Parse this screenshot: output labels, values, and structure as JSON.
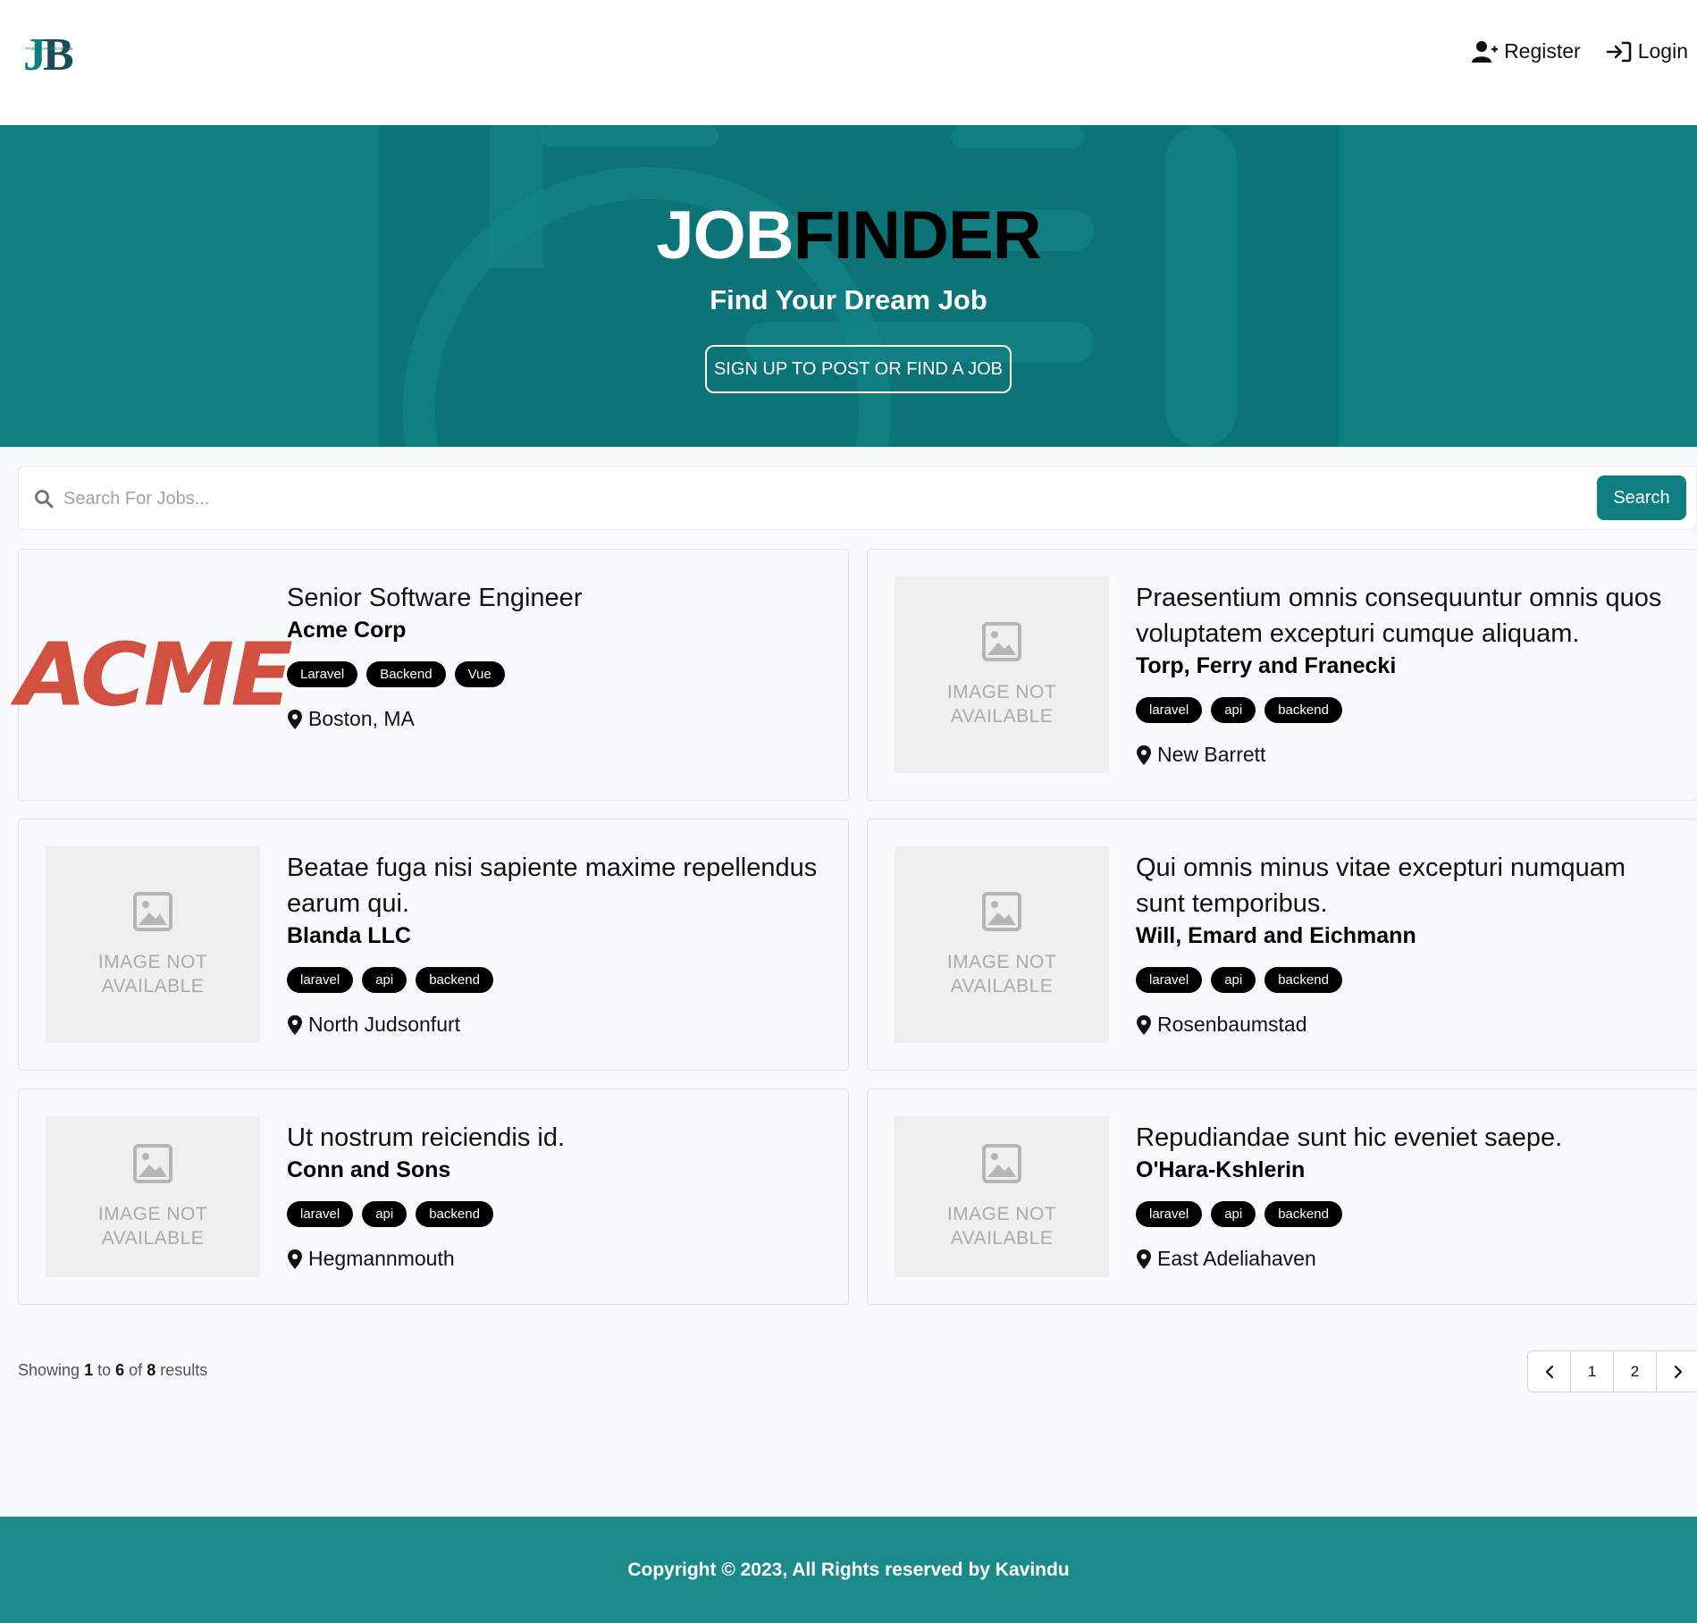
{
  "header": {
    "logo_letters": "JB",
    "logo_tagline": "FIND YOUR DREAM JOB",
    "nav": [
      {
        "label": "Register",
        "icon": "user-plus-icon"
      },
      {
        "label": "Login",
        "icon": "login-icon"
      }
    ]
  },
  "hero": {
    "title_part1": "JOB",
    "title_part2": "FINDER",
    "subtitle": "Find Your Dream Job",
    "button_label": "SIGN UP TO POST OR FIND A JOB"
  },
  "search": {
    "placeholder": "Search For Jobs...",
    "button_label": "Search"
  },
  "jobs": [
    {
      "title": "Senior Software Engineer",
      "company": "Acme Corp",
      "tags": [
        "Laravel",
        "Backend",
        "Vue"
      ],
      "location": "Boston, MA",
      "logo": "ACME"
    },
    {
      "title": "Praesentium omnis consequuntur omnis quos voluptatem excepturi cumque aliquam.",
      "company": "Torp, Ferry and Franecki",
      "tags": [
        "laravel",
        "api",
        "backend"
      ],
      "location": "New Barrett",
      "placeholder_text": "IMAGE NOT AVAILABLE"
    },
    {
      "title": "Beatae fuga nisi sapiente maxime repellendus earum qui.",
      "company": "Blanda LLC",
      "tags": [
        "laravel",
        "api",
        "backend"
      ],
      "location": "North Judsonfurt",
      "placeholder_text": "IMAGE NOT AVAILABLE"
    },
    {
      "title": "Qui omnis minus vitae excepturi numquam sunt temporibus.",
      "company": "Will, Emard and Eichmann",
      "tags": [
        "laravel",
        "api",
        "backend"
      ],
      "location": "Rosenbaumstad",
      "placeholder_text": "IMAGE NOT AVAILABLE"
    },
    {
      "title": "Ut nostrum reiciendis id.",
      "company": "Conn and Sons",
      "tags": [
        "laravel",
        "api",
        "backend"
      ],
      "location": "Hegmannmouth",
      "placeholder_text": "IMAGE NOT AVAILABLE"
    },
    {
      "title": "Repudiandae sunt hic eveniet saepe.",
      "company": "O'Hara-Kshlerin",
      "tags": [
        "laravel",
        "api",
        "backend"
      ],
      "location": "East Adeliahaven",
      "placeholder_text": "IMAGE NOT AVAILABLE"
    }
  ],
  "pagination": {
    "showing": "Showing",
    "from": "1",
    "to_word": "to",
    "to": "6",
    "of_word": "of",
    "total": "8",
    "results_word": "results",
    "pages": [
      "1",
      "2"
    ],
    "prev_icon": "chevron-left-icon",
    "next_icon": "chevron-right-icon"
  },
  "footer": {
    "copyright": "Copyright © 2023, All Rights reserved by Kavindu"
  },
  "colors": {
    "brand": "#0e7e80",
    "footer": "#1a8a8a",
    "acme_red": "#d1503f"
  }
}
